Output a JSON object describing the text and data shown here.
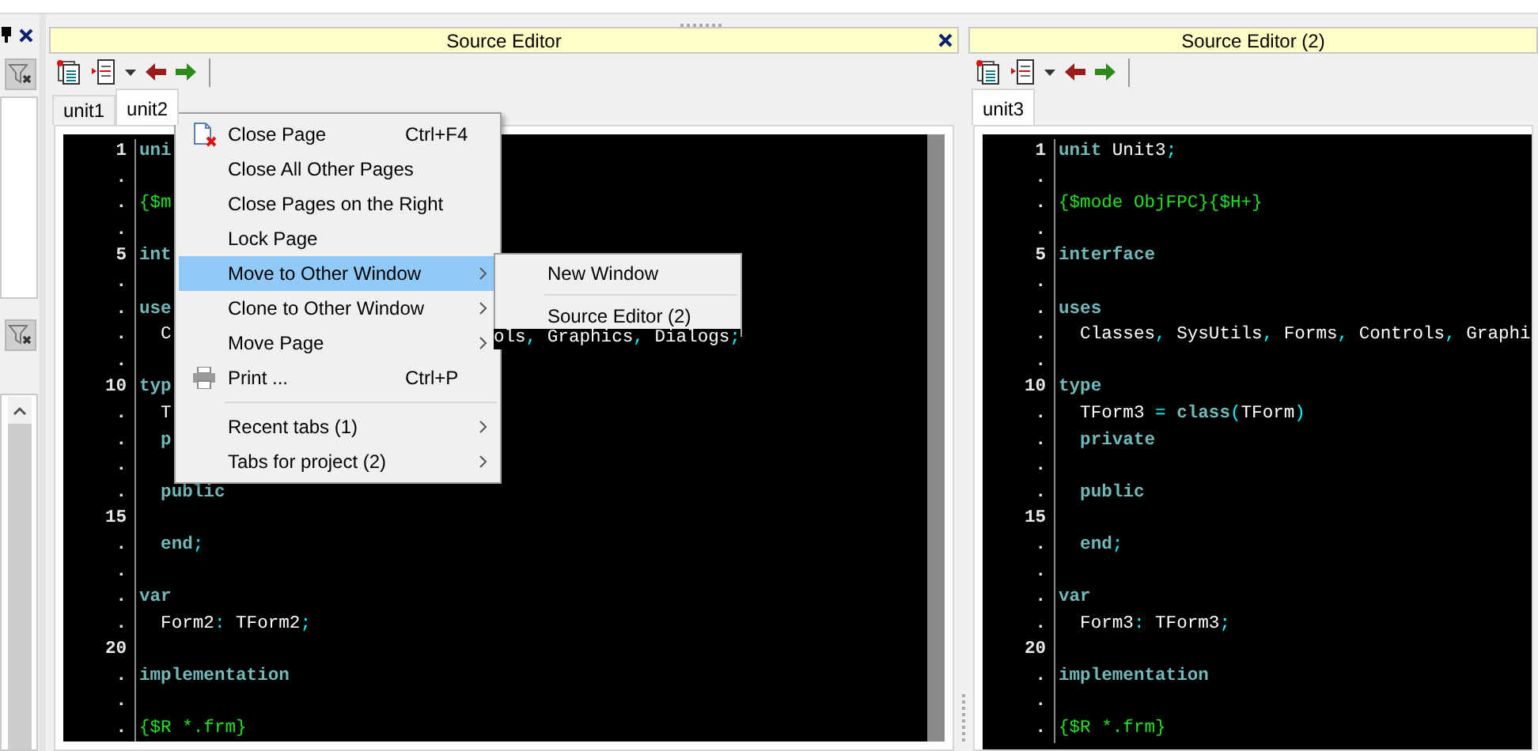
{
  "editors": [
    {
      "title": "Source Editor",
      "tabs": [
        {
          "label": "unit1",
          "selected": false
        },
        {
          "label": "unit2",
          "selected": true
        }
      ],
      "lines": [
        {
          "number": "1",
          "segments": [
            {
              "kind": "keyword",
              "text": "uni"
            }
          ]
        },
        {
          "number": "."
        },
        {
          "number": ".",
          "segments": [
            {
              "kind": "directive",
              "text": "{$m"
            }
          ]
        },
        {
          "number": "."
        },
        {
          "number": "5",
          "segments": [
            {
              "kind": "keyword",
              "text": "int"
            }
          ]
        },
        {
          "number": "."
        },
        {
          "number": ".",
          "segments": [
            {
              "kind": "keyword",
              "text": "use"
            }
          ]
        },
        {
          "number": ".",
          "segments": [
            {
              "kind": "plain",
              "text": "  C"
            }
          ],
          "tail": [
            {
              "kind": "plain",
              "text": "ols"
            },
            {
              "kind": "symbol",
              "text": ","
            },
            {
              "kind": "plain",
              "text": " Graphics"
            },
            {
              "kind": "symbol",
              "text": ","
            },
            {
              "kind": "plain",
              "text": " Dialogs"
            },
            {
              "kind": "symbol",
              "text": ";"
            }
          ]
        },
        {
          "number": "."
        },
        {
          "number": "10",
          "segments": [
            {
              "kind": "keyword",
              "text": "typ"
            }
          ]
        },
        {
          "number": ".",
          "segments": [
            {
              "kind": "plain",
              "text": "  T"
            }
          ]
        },
        {
          "number": ".",
          "segments": [
            {
              "kind": "keyword",
              "text": "  p"
            }
          ]
        },
        {
          "number": "."
        },
        {
          "number": ".",
          "segments": [
            {
              "kind": "keyword",
              "text": "  public"
            }
          ]
        },
        {
          "number": "15"
        },
        {
          "number": ".",
          "segments": [
            {
              "kind": "keyword",
              "text": "  end"
            },
            {
              "kind": "symbol",
              "text": ";"
            }
          ]
        },
        {
          "number": "."
        },
        {
          "number": ".",
          "segments": [
            {
              "kind": "keyword",
              "text": "var"
            }
          ]
        },
        {
          "number": ".",
          "segments": [
            {
              "kind": "plain",
              "text": "  Form2"
            },
            {
              "kind": "symbol",
              "text": ":"
            },
            {
              "kind": "plain",
              "text": " TForm2"
            },
            {
              "kind": "symbol",
              "text": ";"
            }
          ]
        },
        {
          "number": "20"
        },
        {
          "number": ".",
          "segments": [
            {
              "kind": "keyword",
              "text": "implementation"
            }
          ]
        },
        {
          "number": "."
        },
        {
          "number": ".",
          "segments": [
            {
              "kind": "directive",
              "text": "{$R *.frm}"
            }
          ]
        }
      ]
    },
    {
      "title": "Source Editor (2)",
      "tabs": [
        {
          "label": "unit3",
          "selected": true
        }
      ],
      "lines": [
        {
          "number": "1",
          "segments": [
            {
              "kind": "keyword",
              "text": "unit"
            },
            {
              "kind": "plain",
              "text": " Unit3"
            },
            {
              "kind": "symbol",
              "text": ";"
            }
          ]
        },
        {
          "number": "."
        },
        {
          "number": ".",
          "segments": [
            {
              "kind": "directive",
              "text": "{$mode ObjFPC}{$H+}"
            }
          ]
        },
        {
          "number": "."
        },
        {
          "number": "5",
          "segments": [
            {
              "kind": "keyword",
              "text": "interface"
            }
          ]
        },
        {
          "number": "."
        },
        {
          "number": ".",
          "segments": [
            {
              "kind": "keyword",
              "text": "uses"
            }
          ]
        },
        {
          "number": ".",
          "segments": [
            {
              "kind": "plain",
              "text": "  Classes"
            },
            {
              "kind": "symbol",
              "text": ","
            },
            {
              "kind": "plain",
              "text": " SysUtils"
            },
            {
              "kind": "symbol",
              "text": ","
            },
            {
              "kind": "plain",
              "text": " Forms"
            },
            {
              "kind": "symbol",
              "text": ","
            },
            {
              "kind": "plain",
              "text": " Controls"
            },
            {
              "kind": "symbol",
              "text": ","
            },
            {
              "kind": "plain",
              "text": " Graphi"
            }
          ]
        },
        {
          "number": "."
        },
        {
          "number": "10",
          "segments": [
            {
              "kind": "keyword",
              "text": "type"
            }
          ]
        },
        {
          "number": ".",
          "segments": [
            {
              "kind": "plain",
              "text": "  TForm3 "
            },
            {
              "kind": "symbol",
              "text": "= "
            },
            {
              "kind": "keyword",
              "text": "class"
            },
            {
              "kind": "symbol",
              "text": "("
            },
            {
              "kind": "plain",
              "text": "TForm"
            },
            {
              "kind": "symbol",
              "text": ")"
            }
          ]
        },
        {
          "number": ".",
          "segments": [
            {
              "kind": "keyword",
              "text": "  private"
            }
          ]
        },
        {
          "number": "."
        },
        {
          "number": ".",
          "segments": [
            {
              "kind": "keyword",
              "text": "  public"
            }
          ]
        },
        {
          "number": "15"
        },
        {
          "number": ".",
          "segments": [
            {
              "kind": "keyword",
              "text": "  end"
            },
            {
              "kind": "symbol",
              "text": ";"
            }
          ]
        },
        {
          "number": "."
        },
        {
          "number": ".",
          "segments": [
            {
              "kind": "keyword",
              "text": "var"
            }
          ]
        },
        {
          "number": ".",
          "segments": [
            {
              "kind": "plain",
              "text": "  Form3"
            },
            {
              "kind": "symbol",
              "text": ":"
            },
            {
              "kind": "plain",
              "text": " TForm3"
            },
            {
              "kind": "symbol",
              "text": ";"
            }
          ]
        },
        {
          "number": "20"
        },
        {
          "number": ".",
          "segments": [
            {
              "kind": "keyword",
              "text": "implementation"
            }
          ]
        },
        {
          "number": "."
        },
        {
          "number": ".",
          "segments": [
            {
              "kind": "directive",
              "text": "{$R *.frm}"
            }
          ]
        }
      ]
    }
  ],
  "context_menu": {
    "items": [
      {
        "kind": "item",
        "label": "Close Page",
        "shortcut": "Ctrl+F4",
        "submenu": false,
        "selected": false
      },
      {
        "kind": "item",
        "label": "Close All Other Pages",
        "submenu": false,
        "selected": false
      },
      {
        "kind": "item",
        "label": "Close Pages on the Right",
        "submenu": false,
        "selected": false
      },
      {
        "kind": "item",
        "label": "Lock Page",
        "submenu": false,
        "selected": false
      },
      {
        "kind": "item",
        "label": "Move to Other Window",
        "submenu": true,
        "selected": true
      },
      {
        "kind": "item",
        "label": "Clone to Other Window",
        "submenu": true,
        "selected": false
      },
      {
        "kind": "item",
        "label": "Move Page",
        "submenu": true,
        "selected": false
      },
      {
        "kind": "item",
        "label": "Print ...",
        "shortcut": "Ctrl+P",
        "submenu": false,
        "selected": false
      },
      {
        "kind": "separator"
      },
      {
        "kind": "item",
        "label": "Recent tabs (1)",
        "submenu": true,
        "selected": false
      },
      {
        "kind": "item",
        "label": "Tabs for project (2)",
        "submenu": true,
        "selected": false
      }
    ]
  },
  "submenu": {
    "items": [
      {
        "kind": "item",
        "label": "New Window",
        "submenu": false,
        "selected": false
      },
      {
        "kind": "separator"
      },
      {
        "kind": "item",
        "label": "Source Editor (2)",
        "submenu": false,
        "selected": false
      }
    ]
  }
}
